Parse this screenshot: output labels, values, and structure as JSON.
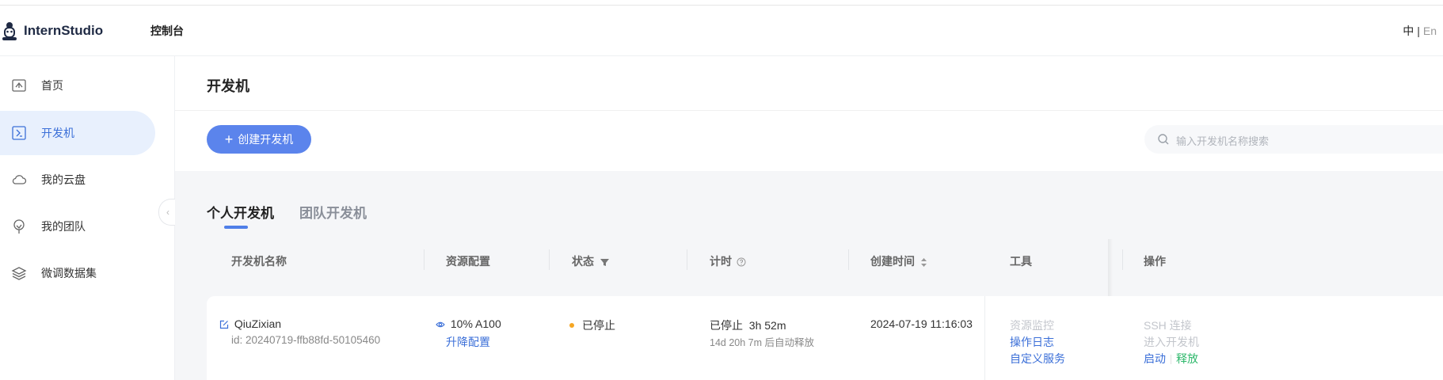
{
  "header": {
    "brand": "InternStudio",
    "console_label": "控制台",
    "lang_current": "中",
    "lang_sep": "|",
    "lang_other": "En"
  },
  "sidebar": {
    "items": [
      {
        "label": "首页",
        "icon": "home-icon"
      },
      {
        "label": "开发机",
        "icon": "terminal-icon",
        "active": true
      },
      {
        "label": "我的云盘",
        "icon": "cloud-icon"
      },
      {
        "label": "我的团队",
        "icon": "team-icon"
      },
      {
        "label": "微调数据集",
        "icon": "layers-icon"
      }
    ],
    "collapse_glyph": "‹"
  },
  "page": {
    "title": "开发机",
    "create_button": "创建开发机",
    "create_glyph": "+",
    "search_placeholder": "输入开发机名称搜索"
  },
  "tabs": [
    {
      "label": "个人开发机",
      "active": true
    },
    {
      "label": "团队开发机",
      "active": false
    }
  ],
  "table": {
    "columns": [
      "开发机名称",
      "资源配置",
      "状态",
      "计时",
      "创建时间",
      "工具",
      "操作"
    ],
    "rows": [
      {
        "name": "QiuZixian",
        "id": "id: 20240719-ffb88fd-50105460",
        "resource": "10% A100",
        "resize": "升降配置",
        "status": "已停止",
        "timer_main": "已停止  3h 52m",
        "timer_sub": "14d 20h 7m 后自动释放",
        "created": "2024-07-19 11:16:03",
        "tools": [
          "资源监控",
          "操作日志",
          "自定义服务"
        ],
        "ops": [
          "SSH 连接",
          "进入开发机",
          "启动",
          "释放"
        ]
      }
    ]
  },
  "colors": {
    "accent": "#5b84ec",
    "link": "#3b6fd8",
    "status_stopped": "#f5a623",
    "release": "#2eb86b"
  }
}
